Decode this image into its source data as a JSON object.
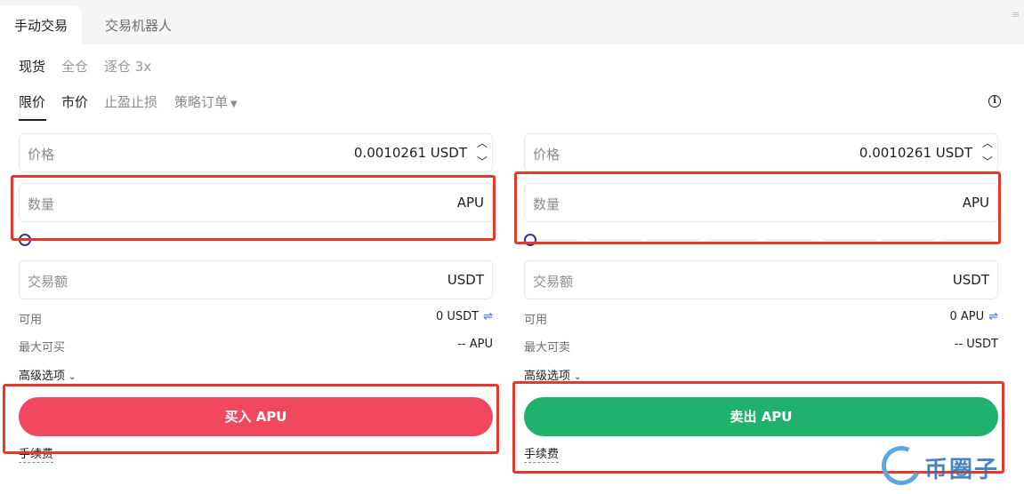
{
  "top_tabs": [
    "手动交易",
    "交易机器人"
  ],
  "margin_modes": [
    "现货",
    "全仓",
    "逐仓 3x"
  ],
  "order_types": [
    "限价",
    "市价",
    "止盈止损",
    "策略订单"
  ],
  "buy_panel": {
    "price_label": "价格",
    "price_value": "0.0010261 USDT",
    "qty_label": "数量",
    "qty_unit": "APU",
    "slider_level": 0,
    "amount_label": "交易额",
    "amount_unit": "USDT",
    "available_label": "可用",
    "available_value": "0 USDT",
    "max_label": "最大可买",
    "max_value": "-- APU",
    "advanced_label": "高级选项",
    "action_label": "买入 APU",
    "fee_label": "手续费"
  },
  "sell_panel": {
    "price_label": "价格",
    "price_value": "0.0010261 USDT",
    "qty_label": "数量",
    "qty_unit": "APU",
    "slider_level": 0,
    "amount_label": "交易额",
    "amount_unit": "USDT",
    "available_label": "可用",
    "available_value": "0 APU",
    "max_label": "最大可卖",
    "max_value": "-- USDT",
    "advanced_label": "高级选项",
    "action_label": "卖出 APU",
    "fee_label": "手续费"
  },
  "watermark": "币圈子",
  "colors": {
    "buy": "#f0485e",
    "sell": "#20b26c",
    "highlight": "#e23b2e",
    "slider_knob": "#2b3a8f"
  },
  "icons": {
    "info": "info-icon",
    "swap": "swap-icon",
    "stepper_up": "chevron-up-icon",
    "stepper_down": "chevron-down-icon"
  }
}
